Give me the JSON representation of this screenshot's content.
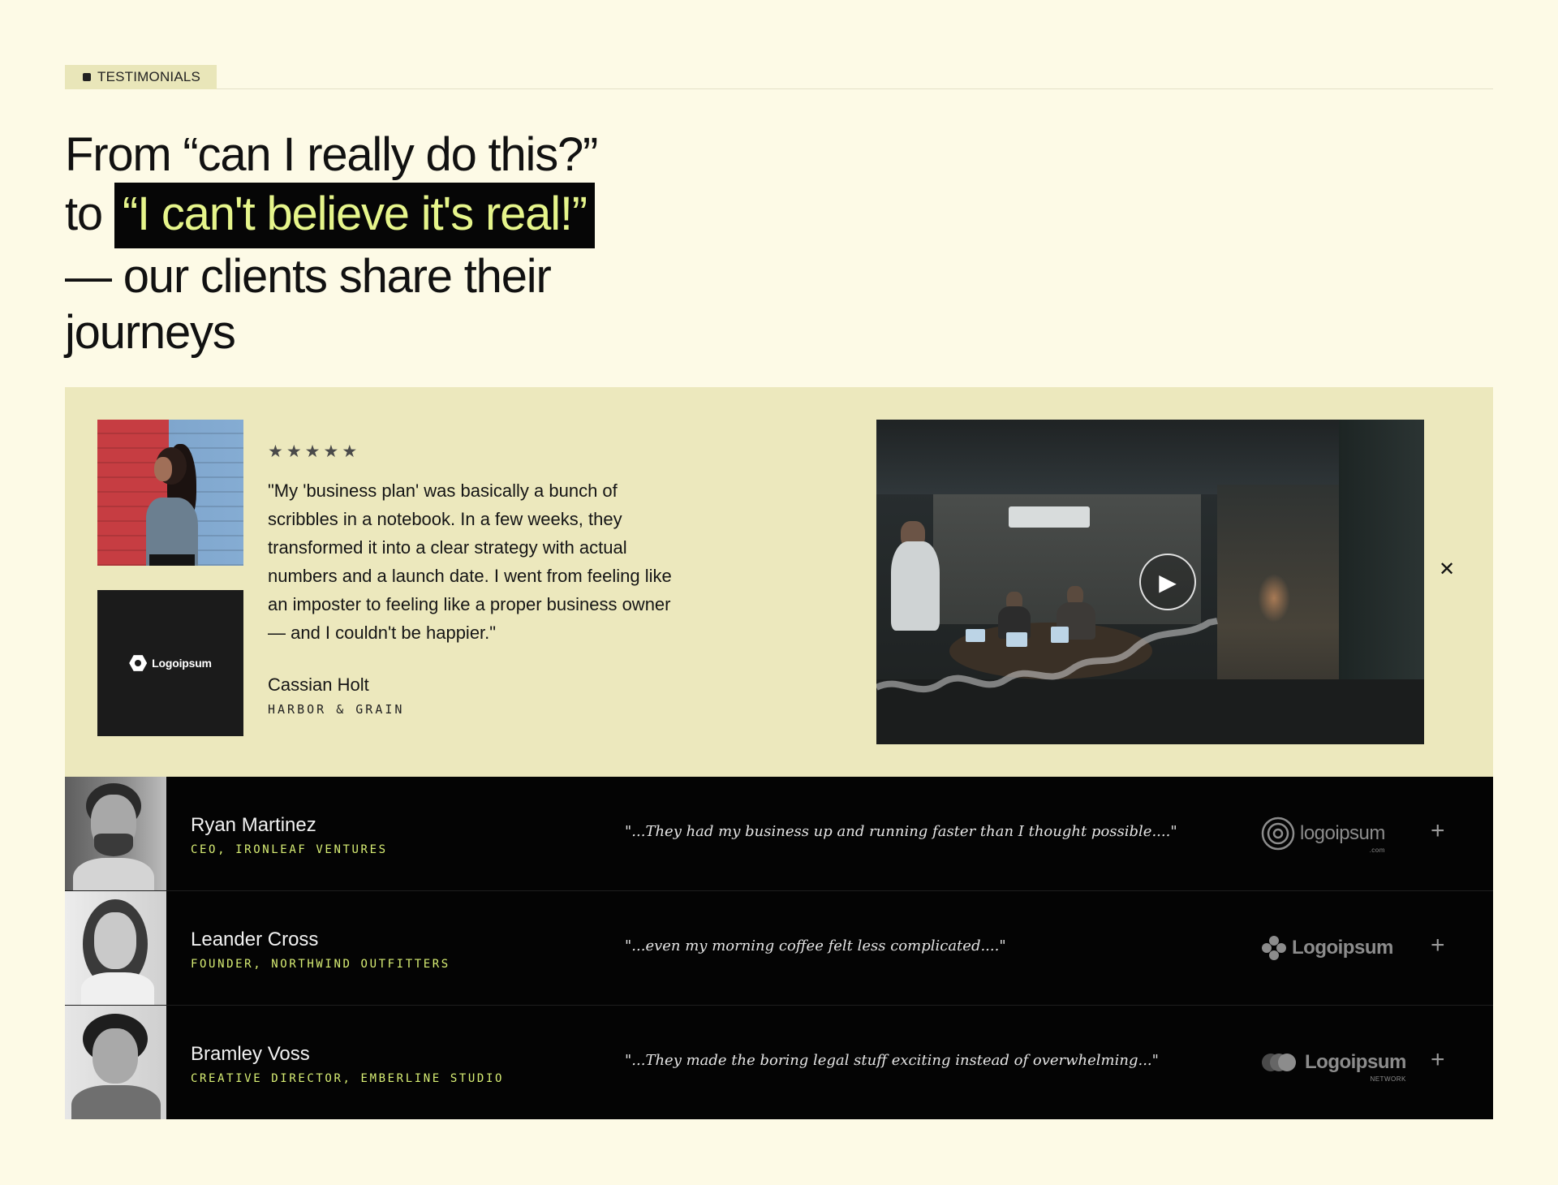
{
  "section": {
    "tag_label": "TESTIMONIALS"
  },
  "heading": {
    "line1": "From “can I really do this?”",
    "to_word": "to",
    "highlight": "“I can't believe it's real!”",
    "rest": "— our clients share their journeys"
  },
  "featured": {
    "rating": 5,
    "stars": [
      "★",
      "★",
      "★",
      "★",
      "★"
    ],
    "quote": "\"My 'business plan' was basically a bunch of scribbles in a notebook. In a few weeks, they transformed it into a clear strategy with actual numbers and a launch date. I went from feeling like an imposter to feeling like a proper business owner — and I couldn't be happier.\"",
    "author": "Cassian Holt",
    "company": "HARBOR & GRAIN",
    "logo_text": "Logoipsum",
    "play_icon": "play-icon",
    "close_icon": "close-icon",
    "close_glyph": "✕",
    "play_glyph": "▶"
  },
  "list": [
    {
      "name": "Ryan Martinez",
      "role": "CEO, IRONLEAF VENTURES",
      "quote": "\"...They had my business up and running faster than I thought possible....\"",
      "logo_text": "logoipsum",
      "logo_sub": ".com",
      "logo_icon": "spiral-icon",
      "plus": "+"
    },
    {
      "name": "Leander Cross",
      "role": "FOUNDER, NORTHWIND OUTFITTERS",
      "quote": "\"...even my morning coffee felt less complicated....\"",
      "logo_text": "Logoipsum",
      "logo_sub": "",
      "logo_icon": "flower-icon",
      "plus": "+"
    },
    {
      "name": "Bramley Voss",
      "role": "CREATIVE DIRECTOR, EMBERLINE STUDIO",
      "quote": "\"...They made the boring legal stuff exciting instead of overwhelming...\"",
      "logo_text": "Logoipsum",
      "logo_sub": "NETWORK",
      "logo_icon": "circles-icon",
      "plus": "+"
    }
  ],
  "colors": {
    "background": "#fdfae6",
    "featured_bg": "#ece8bd",
    "highlight_bg": "#060606",
    "highlight_text": "#e6f58b",
    "role_text": "#d8ee74",
    "list_bg": "#040404"
  }
}
